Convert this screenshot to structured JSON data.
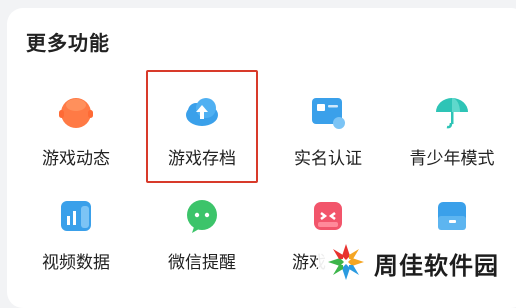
{
  "section": {
    "title": "更多功能"
  },
  "features": [
    {
      "label": "游戏动态",
      "icon": "game-news-icon",
      "color": "#ff7a45"
    },
    {
      "label": "游戏存档",
      "icon": "cloud-save-icon",
      "color": "#3aa0ea"
    },
    {
      "label": "实名认证",
      "icon": "id-card-icon",
      "color": "#3aa0ea"
    },
    {
      "label": "青少年模式",
      "icon": "umbrella-icon",
      "color": "#2ec4b6"
    },
    {
      "label": "视频数据",
      "icon": "video-data-icon",
      "color": "#3aa0ea"
    },
    {
      "label": "微信提醒",
      "icon": "wechat-icon",
      "color": "#3cc46a"
    },
    {
      "label": "游戏",
      "icon": "gamepad-icon",
      "color": "#f2556b"
    },
    {
      "label": "",
      "icon": "box-icon",
      "color": "#3aa0ea"
    }
  ],
  "highlight": {
    "color": "#d83a2a"
  },
  "watermark": {
    "text": "周佳软件园"
  }
}
